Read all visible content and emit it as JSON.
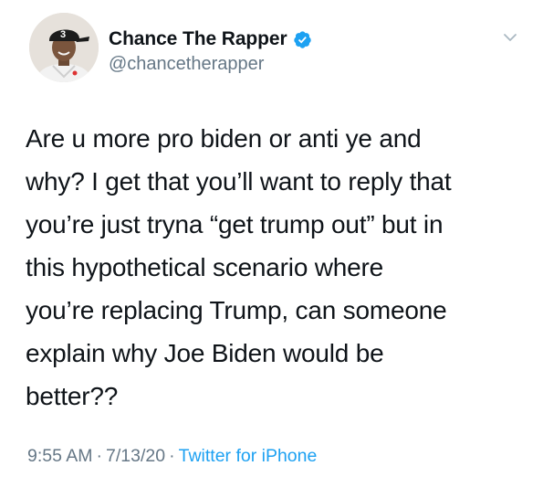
{
  "tweet": {
    "author": {
      "display_name": "Chance The Rapper",
      "handle": "@chancetherapper",
      "verified": true,
      "avatar_cap_number": "3"
    },
    "text": "Are u more pro biden or anti ye and\nwhy? I get that you’ll want to reply that\nyou’re just tryna “get trump out” but in\nthis hypothetical scenario where\nyou’re replacing Trump, can someone\nexplain why Joe Biden would be\nbetter??",
    "time": "9:55 AM",
    "separator": "·",
    "date": "7/13/20",
    "source": "Twitter for iPhone"
  },
  "colors": {
    "text": "#0f1419",
    "secondary": "#657786",
    "link": "#1da1f2",
    "verified_badge": "#1da1f2"
  },
  "icons": {
    "verified": "verified-badge-icon",
    "more": "chevron-down-icon"
  }
}
